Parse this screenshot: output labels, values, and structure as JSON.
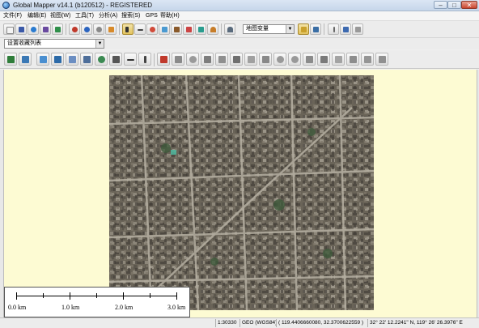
{
  "window": {
    "title": "Global Mapper v14.1 (b120512) - REGISTERED",
    "min_label": "–",
    "max_label": "□",
    "close_label": "✕"
  },
  "menu": [
    "文件(F)",
    "编辑(E)",
    "视图(W)",
    "工具(T)",
    "分析(A)",
    "搜索(S)",
    "GPS",
    "帮助(H)"
  ],
  "toolbar": {
    "layer_combo_value": "地图变量",
    "layer_combo_arrow": "▼",
    "zoom_combo_value": "设置收藏列表",
    "zoom_combo_arrow": "▼"
  },
  "icons": {
    "toolbar1": [
      "new-icon",
      "save-icon",
      "globe-icon",
      "export-icon",
      "connect-icon",
      "zoom-in-icon",
      "zoom-out-icon",
      "home-icon",
      "select-icon",
      "measure-icon",
      "reload-icon",
      "digitize-icon",
      "pan-icon",
      "view3d-icon",
      "shading-icon",
      "overlay-icon",
      "contour-icon",
      "path-profile-icon",
      "layer-control-icon",
      "gps-icon",
      "options-icon",
      "help-icon"
    ],
    "toolbar3": [
      "edit-vertex-icon",
      "move-feature-icon",
      "create-area-icon",
      "create-line-icon",
      "create-point-icon",
      "split-icon",
      "buffer-icon",
      "grid-icon",
      "label-icon",
      "paint-icon",
      "cut-icon",
      "combine-icon",
      "rotate-icon",
      "reshape-icon",
      "smooth-icon",
      "insert-icon",
      "delete-icon",
      "copy-icon",
      "undo-icon",
      "redo-icon",
      "measure-area-icon",
      "measure-line-icon",
      "snap-icon",
      "tag-icon",
      "history-icon"
    ],
    "colors": {
      "accent_green": "#1aa02a",
      "map_background": "#fdfbd3",
      "imagery_tone": "#6e685d"
    }
  },
  "scale": {
    "labels": [
      "0.0 km",
      "1.0 km",
      "2.0 km",
      "3.0 km"
    ]
  },
  "status": {
    "scale": "1:30330",
    "projection": "GEO (WGS84)",
    "coords": "( 119.4406660080, 32.3700622559 )",
    "dms": "32° 22' 12.2241\" N, 119° 26' 26.3976\" E"
  }
}
